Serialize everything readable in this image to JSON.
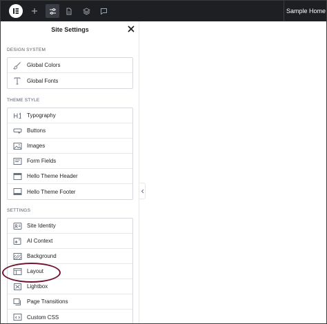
{
  "topbar": {
    "site_name": "Sample Home",
    "icons": [
      "elementor-logo-icon",
      "add-icon",
      "site-settings-icon",
      "page-icon",
      "structure-icon",
      "comments-icon"
    ]
  },
  "panel": {
    "title": "Site Settings",
    "sections": [
      {
        "label": "DESIGN SYSTEM",
        "items": [
          {
            "label": "Global Colors",
            "icon": "brush-icon"
          },
          {
            "label": "Global Fonts",
            "icon": "font-icon"
          }
        ]
      },
      {
        "label": "THEME STYLE",
        "items": [
          {
            "label": "Typography",
            "icon": "heading-icon"
          },
          {
            "label": "Buttons",
            "icon": "button-icon"
          },
          {
            "label": "Images",
            "icon": "image-icon"
          },
          {
            "label": "Form Fields",
            "icon": "form-icon"
          },
          {
            "label": "Hello Theme Header",
            "icon": "header-icon"
          },
          {
            "label": "Hello Theme Footer",
            "icon": "footer-icon"
          }
        ]
      },
      {
        "label": "SETTINGS",
        "items": [
          {
            "label": "Site Identity",
            "icon": "site-identity-icon"
          },
          {
            "label": "AI Context",
            "icon": "ai-icon"
          },
          {
            "label": "Background",
            "icon": "background-icon"
          },
          {
            "label": "Layout",
            "icon": "layout-icon"
          },
          {
            "label": "Lightbox",
            "icon": "lightbox-icon"
          },
          {
            "label": "Page Transitions",
            "icon": "page-transitions-icon"
          },
          {
            "label": "Custom CSS",
            "icon": "custom-css-icon"
          }
        ]
      }
    ]
  },
  "highlight_color": "#6e1230"
}
